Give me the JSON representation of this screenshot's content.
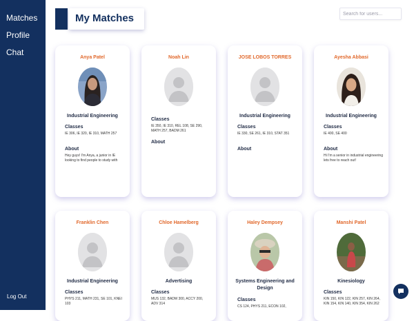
{
  "sidebar": {
    "items": [
      {
        "label": "Matches"
      },
      {
        "label": "Profile"
      },
      {
        "label": "Chat"
      }
    ],
    "logout": "Log Out"
  },
  "header": {
    "title": "My Matches"
  },
  "search": {
    "placeholder": "Search for users..."
  },
  "labels": {
    "classes": "Classes",
    "about": "About"
  },
  "cards": [
    {
      "name": "Anya Patel",
      "major": "Industrial Engineering",
      "classes": "IE 306, IE 320, IE 310, MATH 257",
      "about": "Hey guys! I'm Anya, a junior in IE looking to find people to study with",
      "photo": "girl-dark-hair"
    },
    {
      "name": "Noah Lin",
      "major": "",
      "classes": "IE 350, IE 310, REL 108, SE 290, MATH 257, BADM 261",
      "about": "",
      "photo": "default"
    },
    {
      "name": "JOSE LOBOS TORRES",
      "major": "Industrial Engineering",
      "classes": "IE 330, SE 261, IE 310, STAT 351",
      "about": "",
      "photo": "default"
    },
    {
      "name": "Ayesha Abbasi",
      "major": "Industrial Engineering",
      "classes": "IE 400, SE 400",
      "about": "Hi I'm a senior in industrial engineering lets free to reach out!",
      "photo": "girl-long-hair"
    },
    {
      "name": "Franklin Chen",
      "major": "Industrial Engineering",
      "classes": "PHYS 211, MATH 231, SE 101, KNEI 103",
      "photo": "default"
    },
    {
      "name": "Chloe Hamelberg",
      "major": "Advertising",
      "classes": "MUS 132, BADM 300, ACCY 200, ADV 314",
      "photo": "default"
    },
    {
      "name": "Haley Dempsey",
      "major": "Systems Engineering and Design",
      "classes": "CS 124, PHYS 211, ECON 102,",
      "photo": "girl-hat"
    },
    {
      "name": "Manshi Patel",
      "major": "Kinesiology",
      "classes": "KIN 150, KIN 122, KIN 257, KIN 264, KIN 154, KIN 140, KIN 354, KIN 262",
      "photo": "girl-outdoor"
    }
  ]
}
